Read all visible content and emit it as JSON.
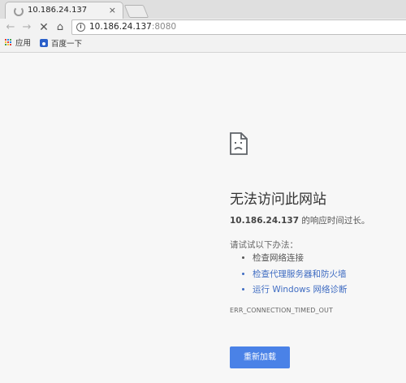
{
  "tab": {
    "title": "10.186.24.137",
    "close": "×"
  },
  "toolbar": {
    "back": "←",
    "forward": "→",
    "stop": "✕",
    "home": "⌂",
    "url_host": "10.186.24.137",
    "url_port": ":8080",
    "info_icon": "i"
  },
  "bookmarks": [
    {
      "label": "应用",
      "icon": "apps-grid-icon"
    },
    {
      "label": "百度一下",
      "icon": "baidu-paw-icon"
    }
  ],
  "error": {
    "title": "无法访问此网站",
    "host": "10.186.24.137",
    "host_suffix": " 的响应时间过长。",
    "try_heading": "请试试以下办法：",
    "suggestions": [
      {
        "text": "检查网络连接",
        "link": false
      },
      {
        "text": "检查代理服务器和防火墙",
        "link": true
      },
      {
        "text": "运行 Windows 网络诊断",
        "link": true
      }
    ],
    "code": "ERR_CONNECTION_TIMED_OUT",
    "reload_label": "重新加载"
  },
  "colors": {
    "accent": "#4a82e7",
    "link": "#3f6cc2",
    "page_bg": "#f7f7f7"
  }
}
